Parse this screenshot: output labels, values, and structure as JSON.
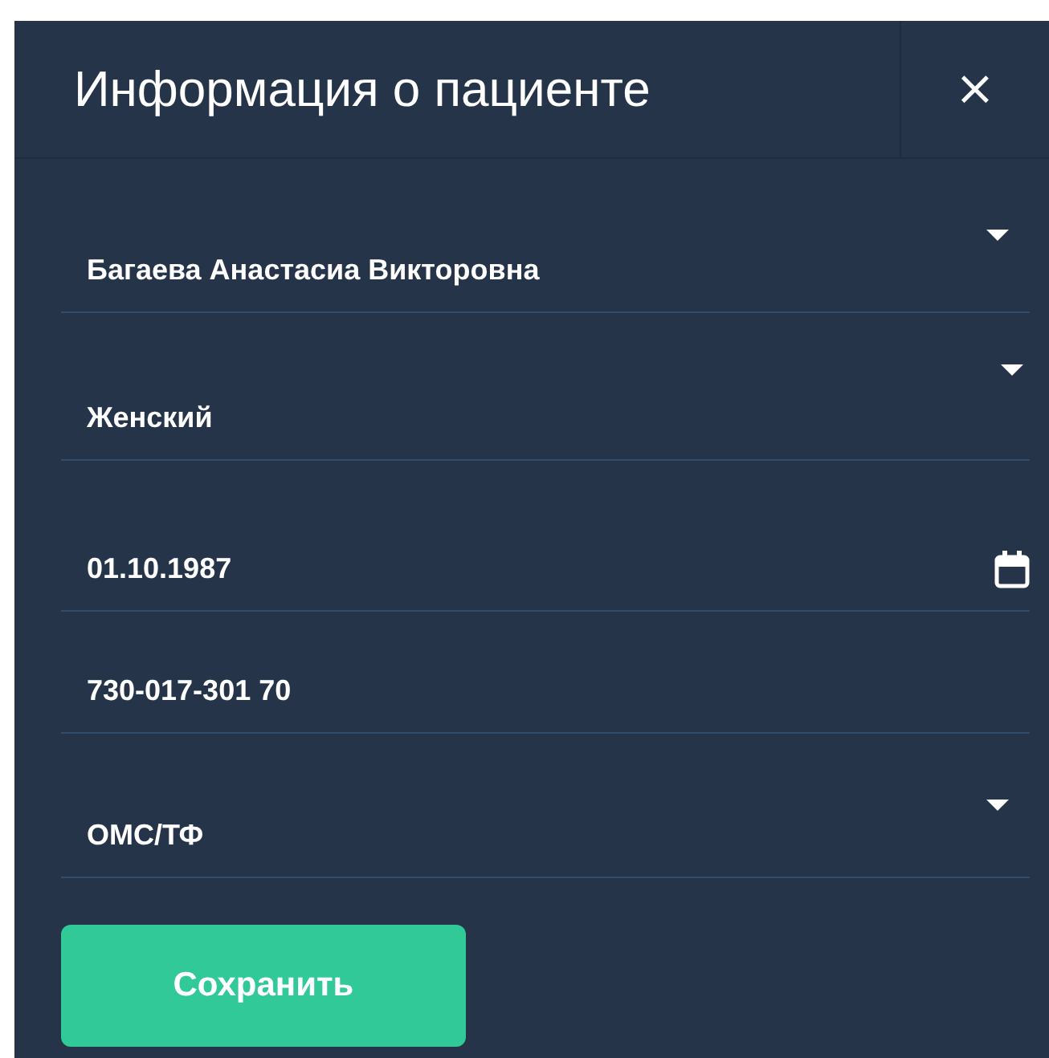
{
  "dialog": {
    "title": "Информация о пациенте",
    "close": "×"
  },
  "fields": [
    {
      "kind": "select",
      "value": "Багаева Анастасиа Викторовна"
    },
    {
      "kind": "select",
      "value": "Женский"
    },
    {
      "kind": "date",
      "value": "01.10.1987"
    },
    {
      "kind": "text",
      "value": "730-017-301 70"
    },
    {
      "kind": "select",
      "value": "ОМС/ТФ"
    }
  ],
  "buttons": [
    {
      "label": "Сохранить"
    }
  ]
}
